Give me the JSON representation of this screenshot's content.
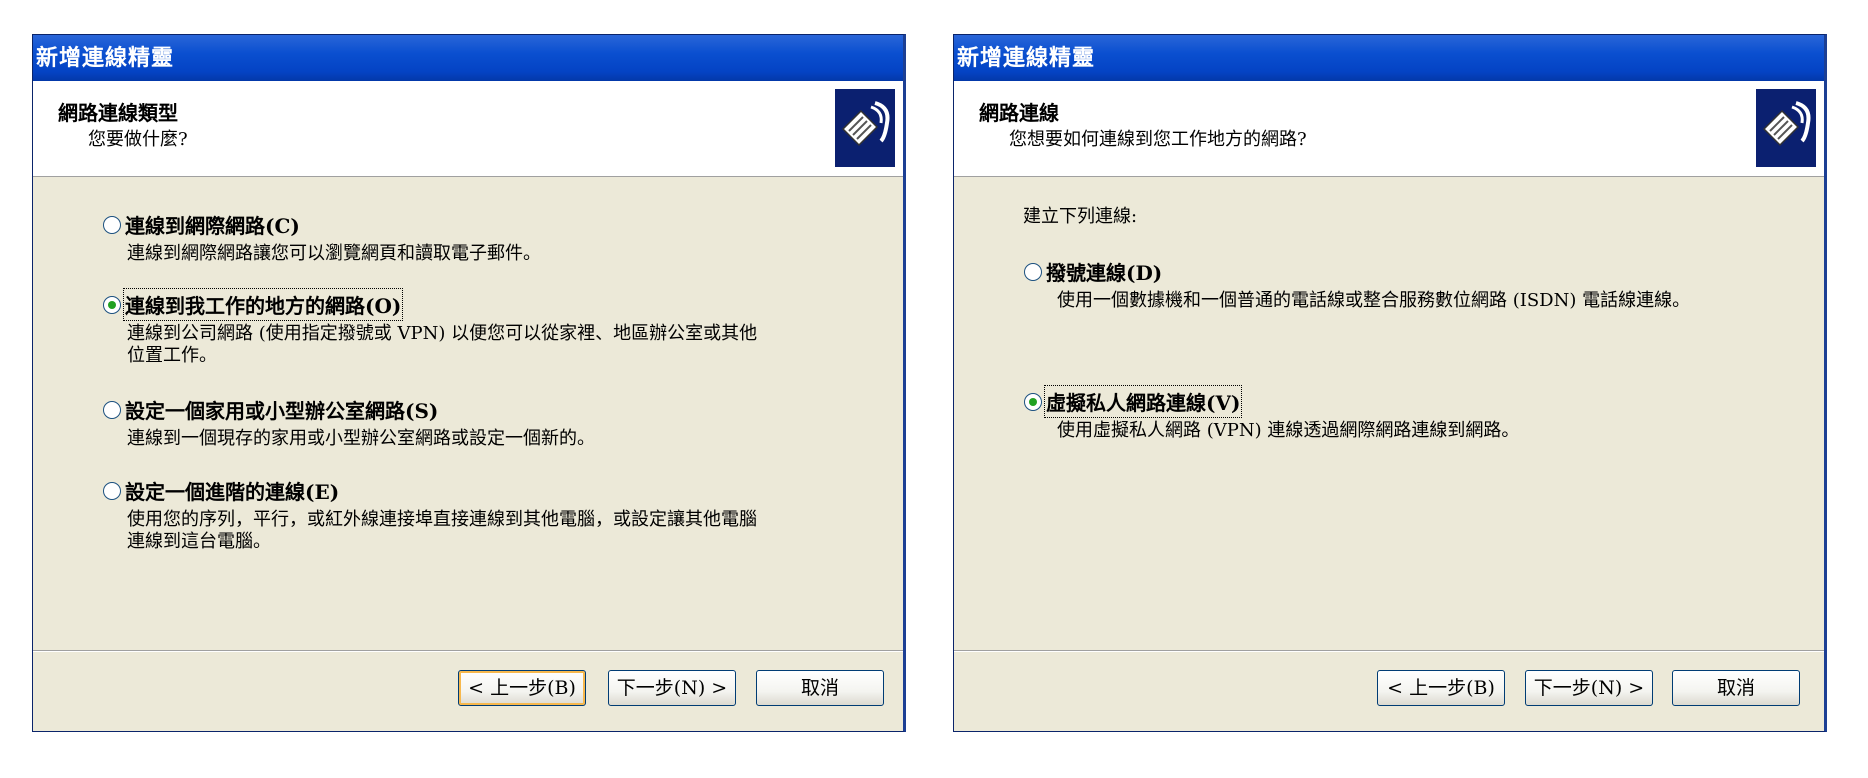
{
  "left": {
    "window_title": "新增連線精靈",
    "header_title": "網路連線類型",
    "header_subtitle": "您要做什麼?",
    "options": [
      {
        "label": "連線到網際網路(C)",
        "desc": [
          "連線到網際網路讓您可以瀏覽網頁和讀取電子郵件。"
        ],
        "checked": false
      },
      {
        "label": "連線到我工作的地方的網路(O)",
        "desc": [
          "連線到公司網路 (使用指定撥號或 VPN) 以便您可以從家裡、地區辦公室或其他",
          "位置工作。"
        ],
        "checked": true
      },
      {
        "label": "設定一個家用或小型辦公室網路(S)",
        "desc": [
          "連線到一個現存的家用或小型辦公室網路或設定一個新的。"
        ],
        "checked": false
      },
      {
        "label": "設定一個進階的連線(E)",
        "desc": [
          "使用您的序列，平行，或紅外線連接埠直接連線到其他電腦，或設定讓其他電腦",
          "連線到這台電腦。"
        ],
        "checked": false
      }
    ],
    "buttons": {
      "back": "< 上一步(B)",
      "next": "下一步(N) >",
      "cancel": "取消"
    }
  },
  "right": {
    "window_title": "新增連線精靈",
    "header_title": "網路連線",
    "header_subtitle": "您想要如何連線到您工作地方的網路?",
    "intro": "建立下列連線:",
    "options": [
      {
        "label": "撥號連線(D)",
        "desc": [
          "使用一個數據機和一個普通的電話線或整合服務數位網路 (ISDN) 電話線連線。"
        ],
        "checked": false
      },
      {
        "label": "虛擬私人網路連線(V)",
        "desc": [
          "使用虛擬私人網路 (VPN) 連線透過網際網路連線到網路。"
        ],
        "checked": true
      }
    ],
    "buttons": {
      "back": "< 上一步(B)",
      "next": "下一步(N) >",
      "cancel": "取消"
    }
  },
  "icons": {
    "header": "network-cable-icon"
  },
  "colors": {
    "titlebar": "#0443c4",
    "dialog_bg": "#ece9d8",
    "radio_dot": "#21a121"
  }
}
